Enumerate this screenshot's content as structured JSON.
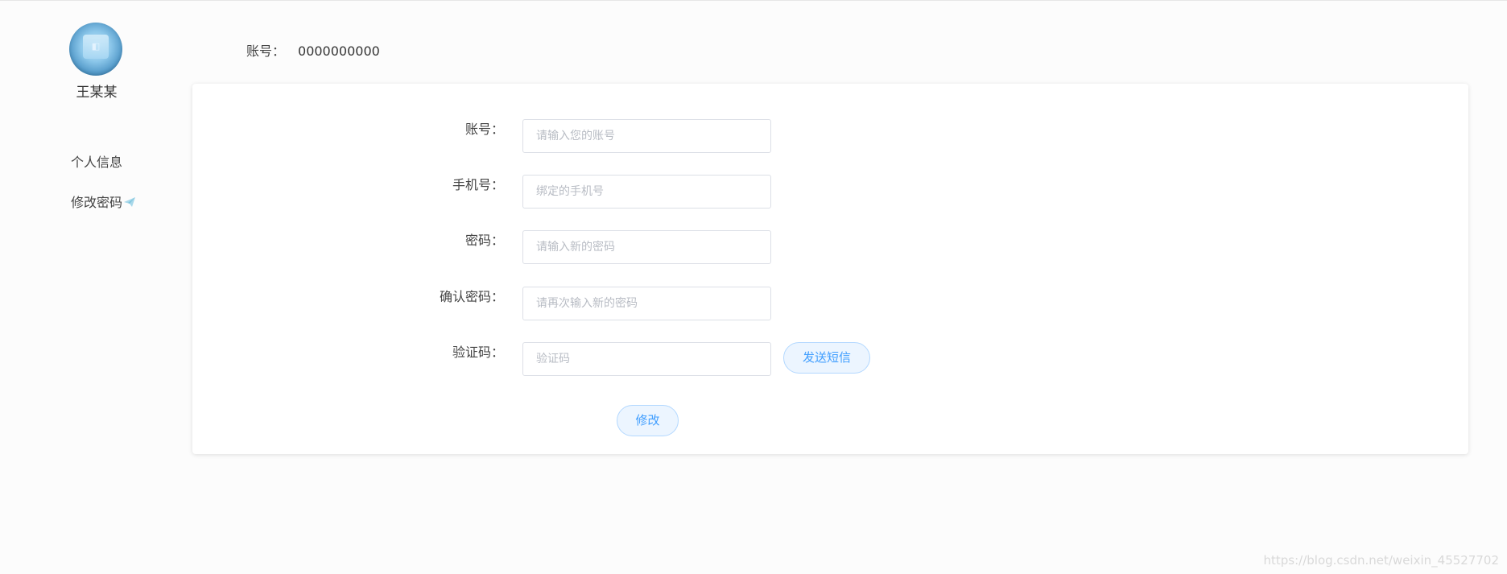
{
  "sidebar": {
    "username": "王某某",
    "items": [
      {
        "label": "个人信息"
      },
      {
        "label": "修改密码",
        "icon": "paper-plane-icon"
      }
    ]
  },
  "header": {
    "account_label": "账号：",
    "account_value": "0000000000"
  },
  "form": {
    "fields": [
      {
        "label": "账号：",
        "placeholder": "请输入您的账号",
        "value": ""
      },
      {
        "label": "手机号：",
        "placeholder": "绑定的手机号",
        "value": ""
      },
      {
        "label": "密码：",
        "placeholder": "请输入新的密码",
        "value": ""
      },
      {
        "label": "确认密码：",
        "placeholder": "请再次输入新的密码",
        "value": ""
      },
      {
        "label": "验证码：",
        "placeholder": "验证码",
        "value": ""
      }
    ],
    "send_sms_label": "发送短信",
    "submit_label": "修改"
  },
  "watermark": "https://blog.csdn.net/weixin_45527702",
  "colors": {
    "accent": "#409eff",
    "button_bg": "#ecf5ff",
    "button_border": "#b3d8ff",
    "page_bg": "#fcfcfc"
  }
}
